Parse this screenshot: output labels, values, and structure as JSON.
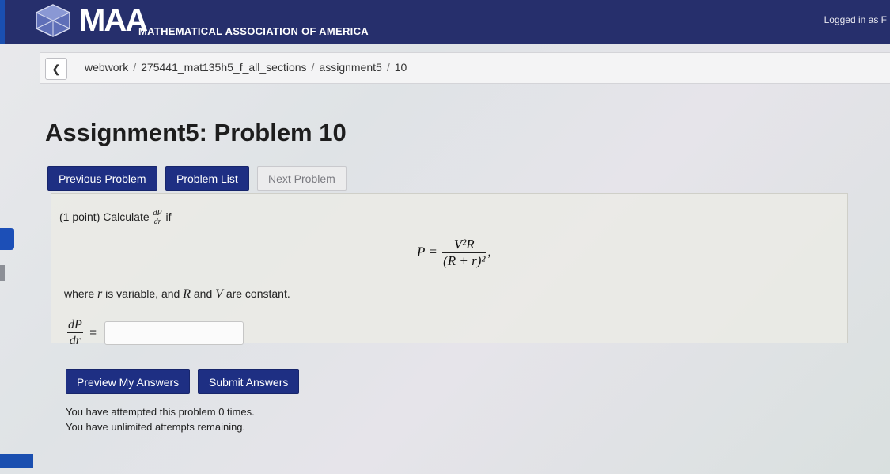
{
  "header": {
    "logo_mark": "MAA",
    "logo_text": "MATHEMATICAL ASSOCIATION OF AMERICA",
    "logged_in": "Logged in as F",
    "bg_color": "#262f6c"
  },
  "breadcrumb": {
    "back_icon": "chevron-left-icon",
    "items": [
      "webwork",
      "275441_mat135h5_f_all_sections",
      "assignment5",
      "10"
    ],
    "separator": "/"
  },
  "page": {
    "title": "Assignment5: Problem 10"
  },
  "nav": {
    "previous": "Previous Problem",
    "list": "Problem List",
    "next": "Next Problem"
  },
  "problem": {
    "intro_prefix": "(1 point) Calculate",
    "intro_frac_num": "dP",
    "intro_frac_den": "dr",
    "intro_suffix": "if",
    "formula_lhs": "P =",
    "formula_num": "V²R",
    "formula_den": "(R + r)²",
    "formula_tail": ",",
    "note_prefix": "where",
    "note_var_r": "r",
    "note_middle": "is variable, and",
    "note_var_R": "R",
    "note_and": "and",
    "note_var_V": "V",
    "note_suffix": "are constant.",
    "answer_num": "dP",
    "answer_den": "dr",
    "answer_eq": "=",
    "answer_value": ""
  },
  "actions": {
    "preview": "Preview My Answers",
    "submit": "Submit Answers"
  },
  "status": {
    "attempts": "You have attempted this problem 0 times.",
    "remaining": "You have unlimited attempts remaining."
  },
  "colors": {
    "primary_button": "#1e2f83",
    "header": "#262f6c"
  }
}
